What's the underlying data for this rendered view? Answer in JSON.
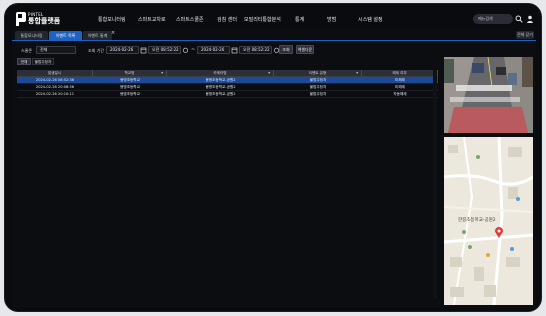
{
  "brand": {
    "sub": "PINTEL",
    "main": "통합플랫폼"
  },
  "nav": [
    "통합모니터링",
    "스마트교차로",
    "스마트스쿨존",
    "검침 센터",
    "모빌리티통합분석",
    "통계",
    "방범",
    "시스템 설정"
  ],
  "search": {
    "placeholder": "메뉴검색"
  },
  "tabs": [
    {
      "label": "통합모니터링"
    },
    {
      "label": "이벤트 목록"
    },
    {
      "label": "이벤트 통계"
    }
  ],
  "tab_close_glyph": "×",
  "close_all_label": "전체 닫기",
  "filters": {
    "school_zone_label": "스쿨존",
    "school_zone_value": "전체",
    "period_label": "조회 기간",
    "start_date": "2024-02-26",
    "start_time": "오전 08:52:22",
    "end_date": "2024-02-26",
    "end_time": "오전 08:52:22",
    "tilde": "~",
    "search_button": "조회",
    "excel_button": "엑셀다운"
  },
  "sub_tabs": [
    "전체",
    "불법주정차"
  ],
  "table": {
    "headers": [
      "발생일시",
      "학교명",
      "카메라명",
      "이벤트 유형",
      "해제 여부"
    ],
    "rows": [
      {
        "cells": [
          "2024-02-26 08:52:36",
          "봉명초등학교",
          "봉명초등학교-공원2",
          "불법주정차",
          "미해제"
        ],
        "selected": true
      },
      {
        "cells": [
          "2024-02-26 20:08:56",
          "봉명초등학교",
          "봉명초등학교-공원2",
          "불법주정차",
          "미해제"
        ],
        "selected": false
      },
      {
        "cells": [
          "2024-02-26 20:10:11",
          "봉명초등학교",
          "봉명초등학교-공원2",
          "불법주정차",
          "자동해제"
        ],
        "selected": false
      }
    ]
  },
  "map": {
    "label": "한길초등학교-공원2"
  },
  "colors": {
    "accent": "#1e63c4",
    "selected_row": "#1c4a98",
    "background": "#0c0d11",
    "marker": "#e53935"
  }
}
